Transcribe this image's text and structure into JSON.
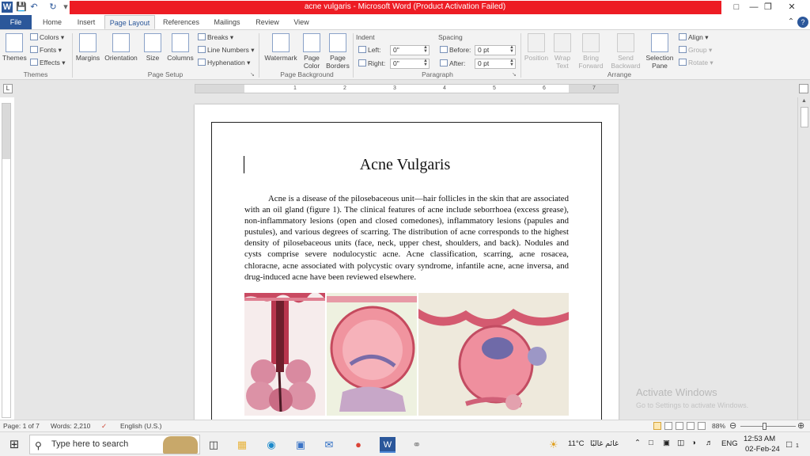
{
  "window": {
    "title": "acne vulgaris  -  Microsoft Word (Product Activation Failed)",
    "help": "?"
  },
  "tabs": [
    {
      "label": "File"
    },
    {
      "label": "Home"
    },
    {
      "label": "Insert"
    },
    {
      "label": "Page Layout"
    },
    {
      "label": "References"
    },
    {
      "label": "Mailings"
    },
    {
      "label": "Review"
    },
    {
      "label": "View"
    }
  ],
  "ribbon": {
    "themes": {
      "themes": "Themes",
      "colors": "Colors",
      "fonts": "Fonts",
      "effects": "Effects",
      "group": "Themes"
    },
    "page_setup": {
      "margins": "Margins",
      "orientation": "Orientation",
      "size": "Size",
      "columns": "Columns",
      "breaks": "Breaks",
      "line_numbers": "Line Numbers",
      "hyphenation": "Hyphenation",
      "group": "Page Setup"
    },
    "page_background": {
      "watermark": "Watermark",
      "page_color_1": "Page",
      "page_color_2": "Color",
      "page_borders_1": "Page",
      "page_borders_2": "Borders",
      "group": "Page Background"
    },
    "paragraph": {
      "indent": "Indent",
      "left_label": "Left:",
      "left_value": "0\"",
      "right_label": "Right:",
      "right_value": "0\"",
      "spacing": "Spacing",
      "before_label": "Before:",
      "before_value": "0 pt",
      "after_label": "After:",
      "after_value": "0 pt",
      "group": "Paragraph"
    },
    "arrange": {
      "position": "Position",
      "wrap_1": "Wrap",
      "wrap_2": "Text",
      "bring_1": "Bring",
      "bring_2": "Forward",
      "send_1": "Send",
      "send_2": "Backward",
      "selection_1": "Selection",
      "selection_2": "Pane",
      "align": "Align",
      "group_btn": "Group",
      "rotate": "Rotate",
      "group": "Arrange"
    }
  },
  "ruler": {
    "numbers": [
      "1",
      "2",
      "3",
      "4",
      "5",
      "6",
      "7"
    ]
  },
  "document": {
    "title": "Acne Vulgaris",
    "paragraph": "Acne is a disease of the pilosebaceous unit—hair follicles in the skin that are associated with an oil gland (figure 1). The clinical features of acne include seborrhoea (excess grease), non-inflammatory lesions (open and closed comedones), inflammatory lesions (papules and pustules), and various degrees of scarring. The distribution of acne corresponds to the highest density of pilosebaceous units (face, neck, upper chest, shoulders, and back). Nodules and cysts comprise severe nodulocystic acne. Acne classification, scarring, acne rosacea, chloracne, acne associated with polycystic ovary syndrome, infantile acne, acne inversa, and drug-induced acne have been reviewed elsewhere."
  },
  "status": {
    "page": "Page: 1 of 7",
    "words": "Words: 2,210",
    "language": "English (U.S.)",
    "zoom": "88%"
  },
  "activation": {
    "line1": "Activate Windows",
    "line2": "Go to Settings to activate Windows."
  },
  "taskbar": {
    "search_placeholder": "Type here to search",
    "weather": "11°C",
    "weather_text": "غائم غالبًا",
    "lang": "ENG",
    "time": "12:53 AM",
    "date": "02-Feb-24",
    "notif": "1"
  }
}
